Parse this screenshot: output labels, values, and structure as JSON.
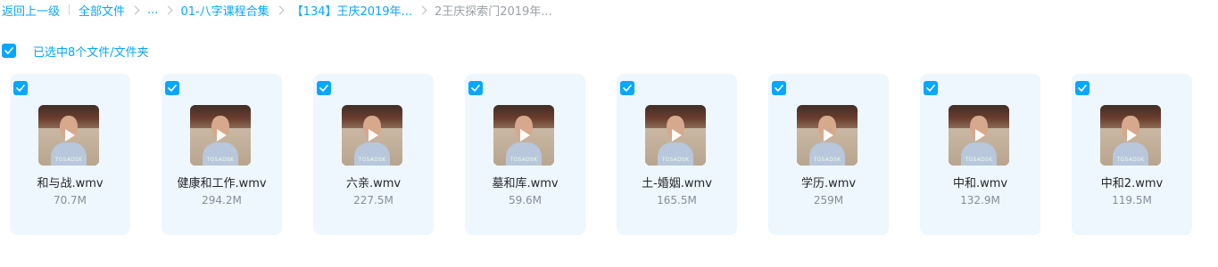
{
  "breadcrumb": {
    "back": "返回上一级",
    "all_files": "全部文件",
    "ellipsis": "...",
    "level1": "01-八字课程合集",
    "level2": "【134】王庆2019年...",
    "current": "2王庆探索门2019年..."
  },
  "selection": {
    "text": "已选中8个文件/文件夹",
    "checked": true
  },
  "thumb_watermark": "TGSADSK",
  "files": [
    {
      "name": "和与战.wmv",
      "size": "70.7M",
      "checked": true
    },
    {
      "name": "健康和工作.wmv",
      "size": "294.2M",
      "checked": true
    },
    {
      "name": "六亲.wmv",
      "size": "227.5M",
      "checked": true
    },
    {
      "name": "墓和库.wmv",
      "size": "59.6M",
      "checked": true
    },
    {
      "name": "土-婚姻.wmv",
      "size": "165.5M",
      "checked": true
    },
    {
      "name": "学历.wmv",
      "size": "259M",
      "checked": true
    },
    {
      "name": "中和.wmv",
      "size": "132.9M",
      "checked": true
    },
    {
      "name": "中和2.wmv",
      "size": "119.5M",
      "checked": true
    }
  ],
  "colors": {
    "accent": "#06a7ff",
    "card_bg": "#eef7fe",
    "name_text": "#25262b",
    "size_text": "#878c9c"
  }
}
